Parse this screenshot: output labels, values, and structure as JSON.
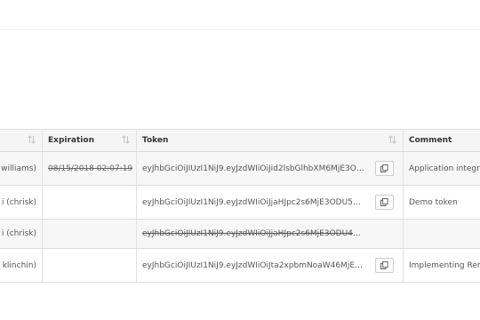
{
  "table": {
    "columns": [
      {
        "label": ""
      },
      {
        "label": "Expiration"
      },
      {
        "label": "Token"
      },
      {
        "label": "Comment"
      }
    ],
    "rows": [
      {
        "user": "williams)",
        "expiration": "08/15/2018 02:07:19",
        "expired": true,
        "token": "eyJhbGciOiJIUzI1NiJ9.eyJzdWIiOiJid2lsbGlhbXM6MjE3O…",
        "token_revoked": false,
        "has_copy": true,
        "comment": "Application integra"
      },
      {
        "user": "i (chrisk)",
        "expiration": "",
        "expired": false,
        "token": "eyJhbGciOiJIUzI1NiJ9.eyJzdWIiOiJjaHJpc2s6MjE3ODU5N…",
        "token_revoked": false,
        "has_copy": true,
        "comment": "Demo token"
      },
      {
        "user": "i (chrisk)",
        "expiration": "",
        "expired": false,
        "token": "eyJhbGciOiJIUzI1NiJ9.eyJzdWIiOiJjaHJpc2s6MjE3ODU4O…",
        "token_revoked": true,
        "has_copy": false,
        "comment": ""
      },
      {
        "user": "klinchin)",
        "expiration": "",
        "expired": false,
        "token": "eyJhbGciOiJIUzI1NiJ9.eyJzdWIiOiJta2xpbmNoaW46MjE3N…",
        "token_revoked": false,
        "has_copy": true,
        "comment": "Implementing Rem"
      }
    ]
  },
  "icons": {
    "sort": "sort-arrows-icon",
    "copy": "copy-icon"
  },
  "colors": {
    "header_bg": "#f5f5f5",
    "striped_bg": "#f7f7f7",
    "border": "#dddddd"
  }
}
